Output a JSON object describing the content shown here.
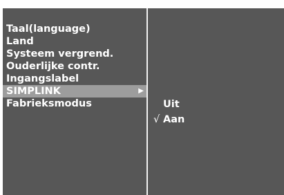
{
  "menu": {
    "items": [
      {
        "label": "Taal(language)"
      },
      {
        "label": "Land"
      },
      {
        "label": "Systeem vergrend."
      },
      {
        "label": "Ouderlijke contr."
      },
      {
        "label": "Ingangslabel"
      },
      {
        "label": "SIMPLINK",
        "selected": true,
        "submenu_arrow": "▶"
      },
      {
        "label": "Fabrieksmodus"
      }
    ]
  },
  "submenu": {
    "options": [
      {
        "label": "Uit",
        "checked": false
      },
      {
        "label": "Aan",
        "checked": true,
        "check_mark": "√"
      }
    ]
  },
  "colors": {
    "panel_background": "#575757",
    "selected_highlight": "#9d9d9d",
    "text": "#ffffff",
    "divider": "#f2f2f2"
  }
}
